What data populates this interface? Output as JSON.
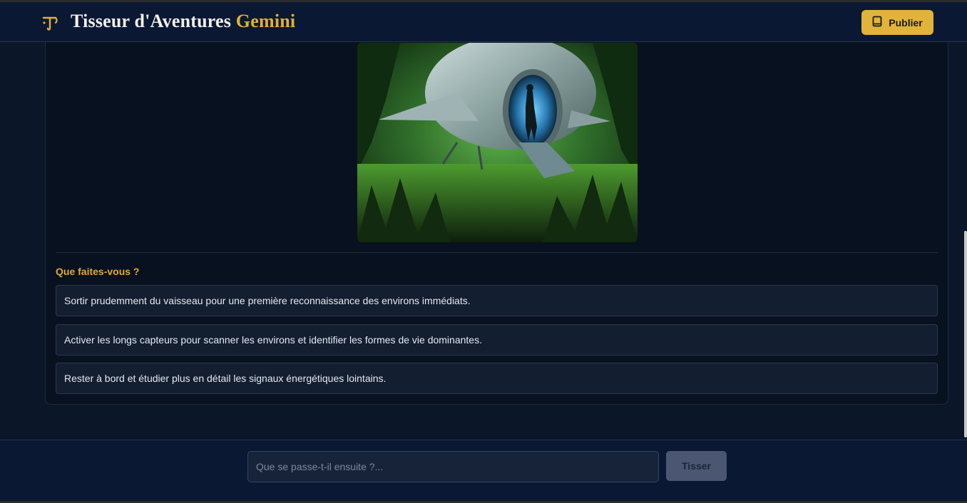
{
  "header": {
    "title_main": "Tisseur d'Aventures",
    "title_accent": "Gemini",
    "logo_icon": "quill-icon",
    "publish_label": "Publier",
    "publish_icon": "book-icon"
  },
  "story": {
    "image_alt": "scene-illustration",
    "question": "Que faites-vous ?",
    "choices": [
      {
        "label": "Sortir prudemment du vaisseau pour une première reconnaissance des environs immédiats."
      },
      {
        "label": "Activer les longs capteurs pour scanner les environs et identifier les formes de vie dominantes."
      },
      {
        "label": "Rester à bord et étudier plus en détail les signaux énergétiques lointains."
      }
    ]
  },
  "composer": {
    "placeholder": "Que se passe-t-il ensuite ?...",
    "submit_label": "Tisser"
  },
  "colors": {
    "accent": "#e0b03c",
    "background": "#0b1629",
    "header_bg": "#0b1833"
  }
}
